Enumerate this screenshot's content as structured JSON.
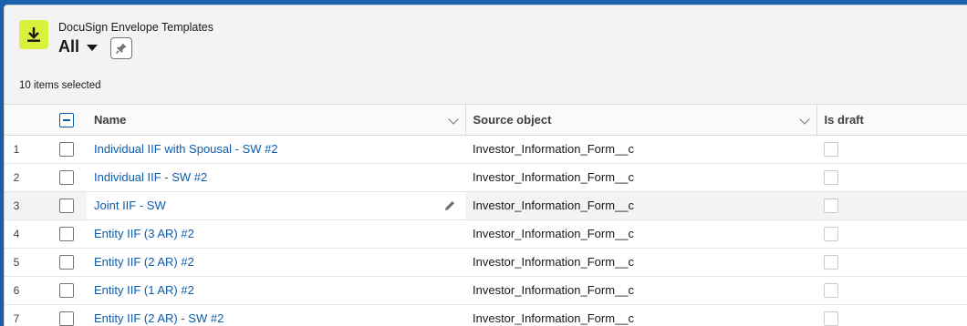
{
  "header": {
    "object_label": "DocuSign Envelope Templates",
    "list_view": "All",
    "selected_count": "10 items selected"
  },
  "table": {
    "columns": {
      "name": "Name",
      "source": "Source object",
      "draft": "Is draft"
    },
    "rows": [
      {
        "num": "1",
        "name": "Individual IIF with Spousal - SW #2",
        "source": "Investor_Information_Form__c"
      },
      {
        "num": "2",
        "name": "Individual IIF - SW #2",
        "source": "Investor_Information_Form__c"
      },
      {
        "num": "3",
        "name": "Joint IIF - SW",
        "source": "Investor_Information_Form__c"
      },
      {
        "num": "4",
        "name": "Entity IIF (3 AR) #2",
        "source": "Investor_Information_Form__c"
      },
      {
        "num": "5",
        "name": "Entity IIF (2 AR) #2",
        "source": "Investor_Information_Form__c"
      },
      {
        "num": "6",
        "name": "Entity IIF (1 AR) #2",
        "source": "Investor_Information_Form__c"
      },
      {
        "num": "7",
        "name": "Entity IIF (2 AR) - SW #2",
        "source": "Investor_Information_Form__c"
      }
    ]
  },
  "colors": {
    "accent": "#0b5cab",
    "object_icon": "#d9f03c",
    "background": "#1b5ea8"
  },
  "icons": {
    "object": "download-icon",
    "pin": "pin-icon",
    "edit": "pencil-icon"
  }
}
